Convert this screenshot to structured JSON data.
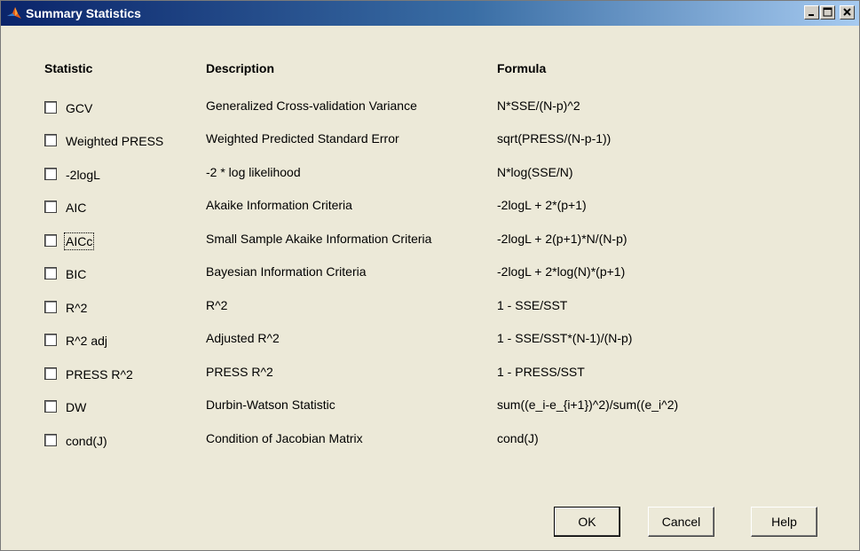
{
  "window": {
    "title": "Summary Statistics",
    "controls": [
      "minimize-icon",
      "maximize-icon",
      "close-icon"
    ]
  },
  "columns": {
    "statistic": "Statistic",
    "description": "Description",
    "formula": "Formula"
  },
  "rows": [
    {
      "label": "GCV",
      "checked": false,
      "description": "Generalized Cross-validation Variance",
      "formula": "N*SSE/(N-p)^2"
    },
    {
      "label": "Weighted PRESS",
      "checked": false,
      "description": "Weighted Predicted Standard Error",
      "formula": "sqrt(PRESS/(N-p-1))"
    },
    {
      "label": "-2logL",
      "checked": false,
      "description": "-2 * log likelihood",
      "formula": "N*log(SSE/N)"
    },
    {
      "label": "AIC",
      "checked": false,
      "description": "Akaike Information Criteria",
      "formula": "-2logL + 2*(p+1)"
    },
    {
      "label": "AICc",
      "checked": false,
      "description": "Small Sample Akaike Information Criteria",
      "formula": "-2logL + 2(p+1)*N/(N-p)"
    },
    {
      "label": "BIC",
      "checked": false,
      "description": "Bayesian Information Criteria",
      "formula": "-2logL + 2*log(N)*(p+1)"
    },
    {
      "label": "R^2",
      "checked": false,
      "description": "R^2",
      "formula": "1 - SSE/SST"
    },
    {
      "label": "R^2 adj",
      "checked": false,
      "description": "Adjusted R^2",
      "formula": "1 - SSE/SST*(N-1)/(N-p)"
    },
    {
      "label": "PRESS R^2",
      "checked": false,
      "description": "PRESS R^2",
      "formula": "1 - PRESS/SST"
    },
    {
      "label": "DW",
      "checked": false,
      "description": "Durbin-Watson Statistic",
      "formula": "sum((e_i-e_{i+1})^2)/sum((e_i^2)"
    },
    {
      "label": "cond(J)",
      "checked": false,
      "description": "Condition of Jacobian Matrix",
      "formula": "cond(J)"
    }
  ],
  "buttons": {
    "ok": "OK",
    "cancel": "Cancel",
    "help": "Help"
  },
  "colors": {
    "titlebar_start": "#0a246a",
    "titlebar_end": "#a6caf0",
    "dialog_bg": "#ece9d8"
  }
}
